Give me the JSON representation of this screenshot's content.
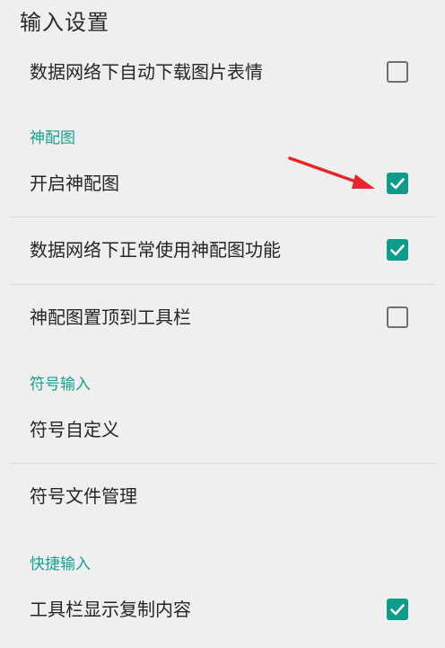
{
  "page": {
    "title": "输入设置"
  },
  "settings": {
    "auto_download_images": {
      "label": "数据网络下自动下载图片表情",
      "checked": false
    },
    "section_shenpeitu": {
      "label": "神配图"
    },
    "enable_shenpeitu": {
      "label": "开启神配图",
      "checked": true
    },
    "shenpeitu_mobile_data": {
      "label": "数据网络下正常使用神配图功能",
      "checked": true
    },
    "shenpeitu_pin_toolbar": {
      "label": "神配图置顶到工具栏",
      "checked": false
    },
    "section_symbol": {
      "label": "符号输入"
    },
    "symbol_custom": {
      "label": "符号自定义"
    },
    "symbol_file_manage": {
      "label": "符号文件管理"
    },
    "section_quick": {
      "label": "快捷输入"
    },
    "toolbar_show_copy": {
      "label": "工具栏显示复制内容",
      "checked": true
    }
  },
  "colors": {
    "accent": "#0e9b8c",
    "section_text": "#1a9e8f",
    "arrow": "#e5262a",
    "background": "#efefef"
  }
}
